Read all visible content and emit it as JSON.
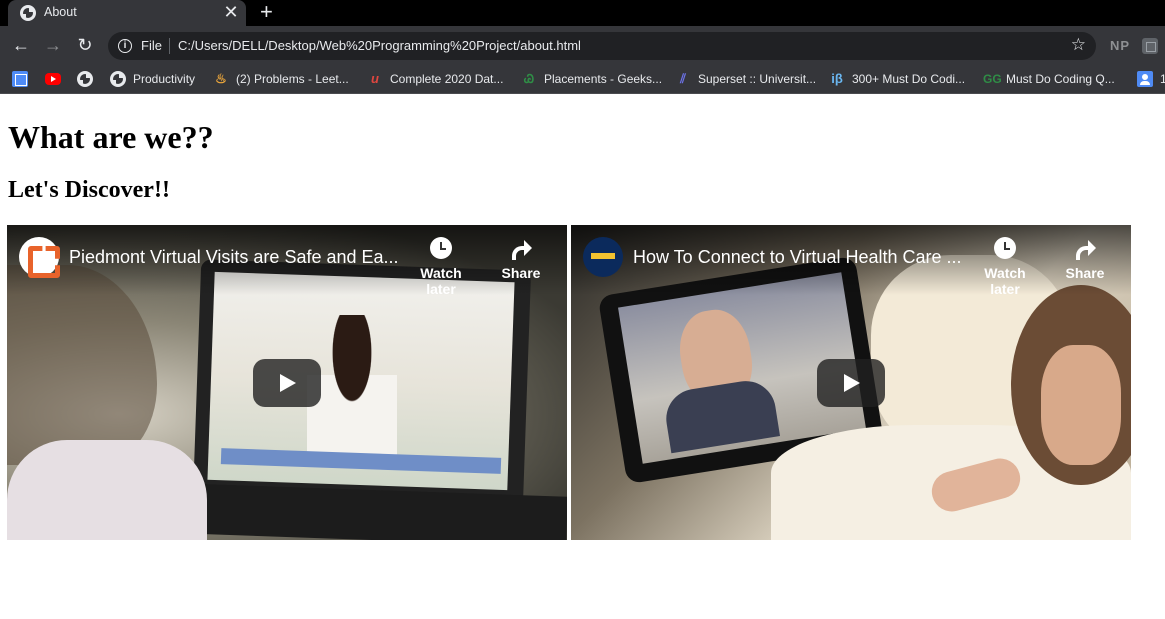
{
  "browser": {
    "tab": {
      "title": "About",
      "close": "✕"
    },
    "new_tab": "+",
    "nav": {
      "back": "←",
      "forward": "→",
      "reload": "↻"
    },
    "omnibox": {
      "scheme": "File",
      "url": "C:/Users/DELL/Desktop/Web%20Programming%20Project/about.html",
      "star": "☆"
    },
    "extensions": {
      "np": "NP"
    },
    "bookmarks": [
      {
        "label": "",
        "icon": "apps-icon"
      },
      {
        "label": "",
        "icon": "youtube-icon"
      },
      {
        "label": "",
        "icon": "globe-icon"
      },
      {
        "label": "Productivity",
        "icon": "globe-icon"
      },
      {
        "label": "(2) Problems - Leet...",
        "icon": "leetcode-icon"
      },
      {
        "label": "Complete 2020 Dat...",
        "icon": "udemy-icon"
      },
      {
        "label": "Placements - Geeks...",
        "icon": "geeksforgeeks-icon"
      },
      {
        "label": "Superset :: Universit...",
        "icon": "superset-icon"
      },
      {
        "label": "300+ Must Do Codi...",
        "icon": "interviewbit-icon"
      },
      {
        "label": "Must Do Coding Q...",
        "icon": "geeksforgeeks-icon"
      },
      {
        "label": "1",
        "icon": "person-icon"
      }
    ],
    "icons": {
      "lc": "♨",
      "rn": "u",
      "gfg": "Ꮚ",
      "sup": "⫽",
      "ib": "iβ",
      "gfg2": "GG"
    }
  },
  "page": {
    "heading": "What are we??",
    "subheading": "Let's Discover!!"
  },
  "videos": [
    {
      "title": "Piedmont Virtual Visits are Safe and Ea...",
      "watch_later": "Watch later",
      "share": "Share"
    },
    {
      "title": "How To Connect to Virtual Health Care ...",
      "watch_later": "Watch later",
      "share": "Share"
    }
  ],
  "colors": {
    "tabstrip": "#000000",
    "toolbar": "#35363a",
    "omnibox": "#202124",
    "text_light": "#e8eaed"
  }
}
